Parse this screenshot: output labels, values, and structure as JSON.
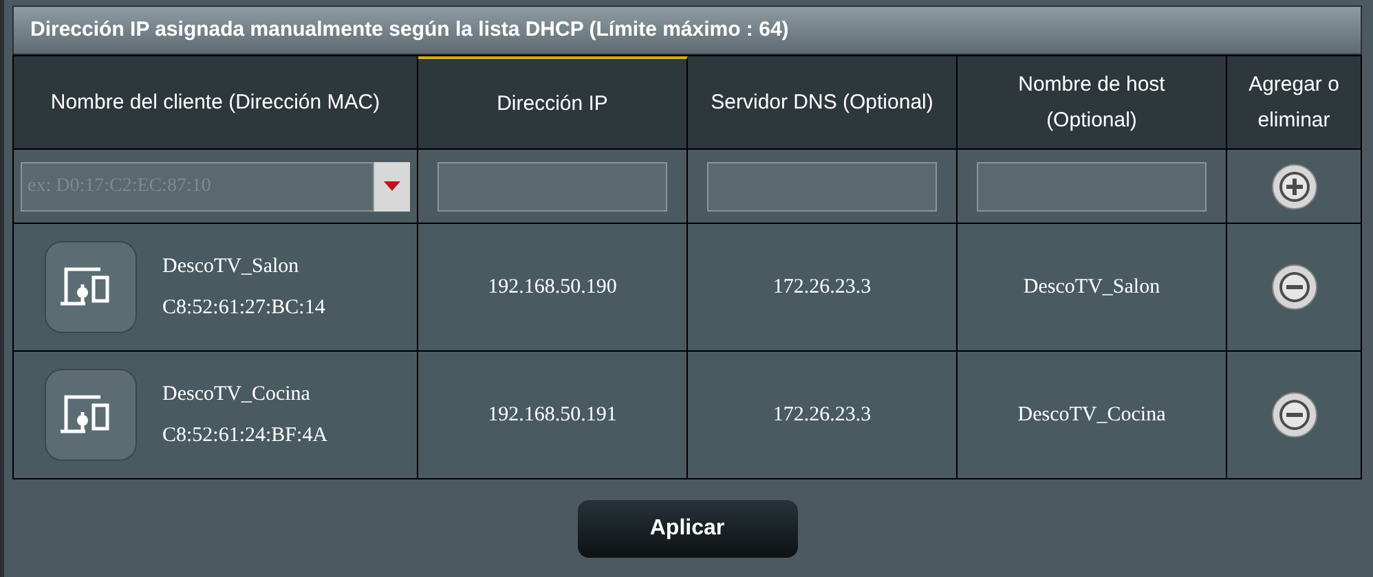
{
  "title": "Dirección IP asignada manualmente según la lista DHCP (Límite máximo : 64)",
  "table": {
    "columns": [
      {
        "label": "Nombre del cliente (Dirección MAC)",
        "selected": false
      },
      {
        "label": "Dirección IP",
        "selected": true
      },
      {
        "label": "Servidor DNS (Optional)",
        "selected": false
      },
      {
        "label": "Nombre de host (Optional)",
        "selected": false
      },
      {
        "label": "Agregar o eliminar",
        "selected": false
      }
    ],
    "input_row": {
      "mac_placeholder": "ex: D0:17:C2:EC:87:10"
    },
    "rows": [
      {
        "name": "DescoTV_Salon",
        "mac": "C8:52:61:27:BC:14",
        "ip": "192.168.50.190",
        "dns": "172.26.23.3",
        "host": "DescoTV_Salon"
      },
      {
        "name": "DescoTV_Cocina",
        "mac": "C8:52:61:24:BF:4A",
        "ip": "192.168.50.191",
        "dns": "172.26.23.3",
        "host": "DescoTV_Cocina"
      }
    ]
  },
  "apply_button": "Aplicar"
}
